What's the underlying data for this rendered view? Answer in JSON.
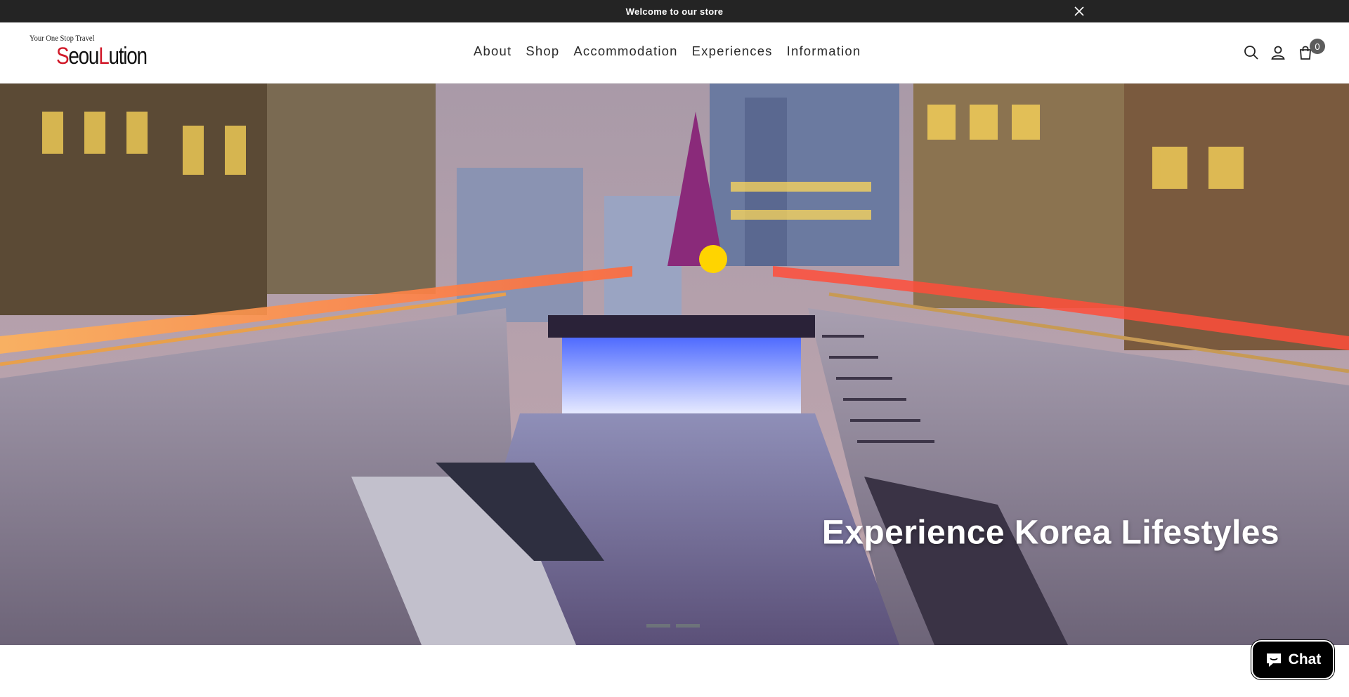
{
  "announcement": {
    "text": "Welcome to our store"
  },
  "logo": {
    "tagline": "Your One Stop Travel",
    "word_before": "Seou",
    "word_red_initial": "L",
    "word_after": "ution"
  },
  "nav": {
    "items": [
      "About",
      "Shop",
      "Accommodation",
      "Experiences",
      "Information"
    ]
  },
  "header": {
    "icons": [
      "search-icon",
      "account-icon",
      "cart-icon"
    ],
    "cart_count": "0"
  },
  "hero": {
    "heading": "Experience Korea Lifestyles",
    "slides": 2
  },
  "chat": {
    "label": "Chat"
  },
  "colors": {
    "announcement_bg": "#242424",
    "cart_badge": "#5c5c5c",
    "logo_red": "#d11a2a",
    "chat_bg": "#000000"
  }
}
